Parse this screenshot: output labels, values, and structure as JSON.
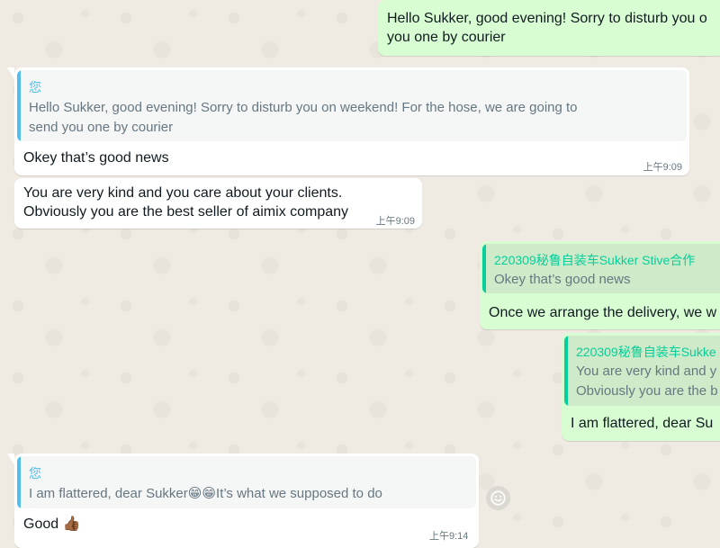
{
  "colors": {
    "incoming_bubble": "#ffffff",
    "outgoing_bubble": "#d9fdd3",
    "quote_bar_self": "#53bdeb",
    "quote_bar_contact": "#06cf9c",
    "contact_name": "#06cf9c",
    "self_name": "#53bdeb"
  },
  "messages": {
    "m1": {
      "text_line1": "Hello Sukker, good evening! Sorry to disturb you o",
      "text_line2": "you one by courier"
    },
    "m2": {
      "quote_author": "您",
      "quote_line1": "Hello Sukker, good evening! Sorry to disturb you on weekend! For the hose, we are going to",
      "quote_line2": "send you one by courier",
      "text": "Okey that’s good news",
      "time": "上午9:09"
    },
    "m3": {
      "text_line1": "You are very kind and you care about your clients.",
      "text_line2": "Obviously you are the best seller of aimix company",
      "time": "上午9:09"
    },
    "m4": {
      "quote_author": "220309秘鲁自装车Sukker Stive合作",
      "quote_line1": "Okey that’s good news",
      "text": "Once we arrange the delivery, we w"
    },
    "m5": {
      "quote_author": "220309秘鲁自装车Sukke",
      "quote_line1": "You are very kind and y",
      "quote_line2": "Obviously you are the b",
      "text": "I am flattered, dear Su"
    },
    "m6": {
      "quote_author": "您",
      "quote_line1a": "I am flattered, dear Sukker",
      "quote_emoji": "😁😁",
      "quote_line1b": "It’s what we supposed to do",
      "text": "Good",
      "text_emoji": "👍🏾",
      "time": "上午9:14"
    }
  },
  "icons": {
    "emoji_button": "smiley-icon"
  }
}
